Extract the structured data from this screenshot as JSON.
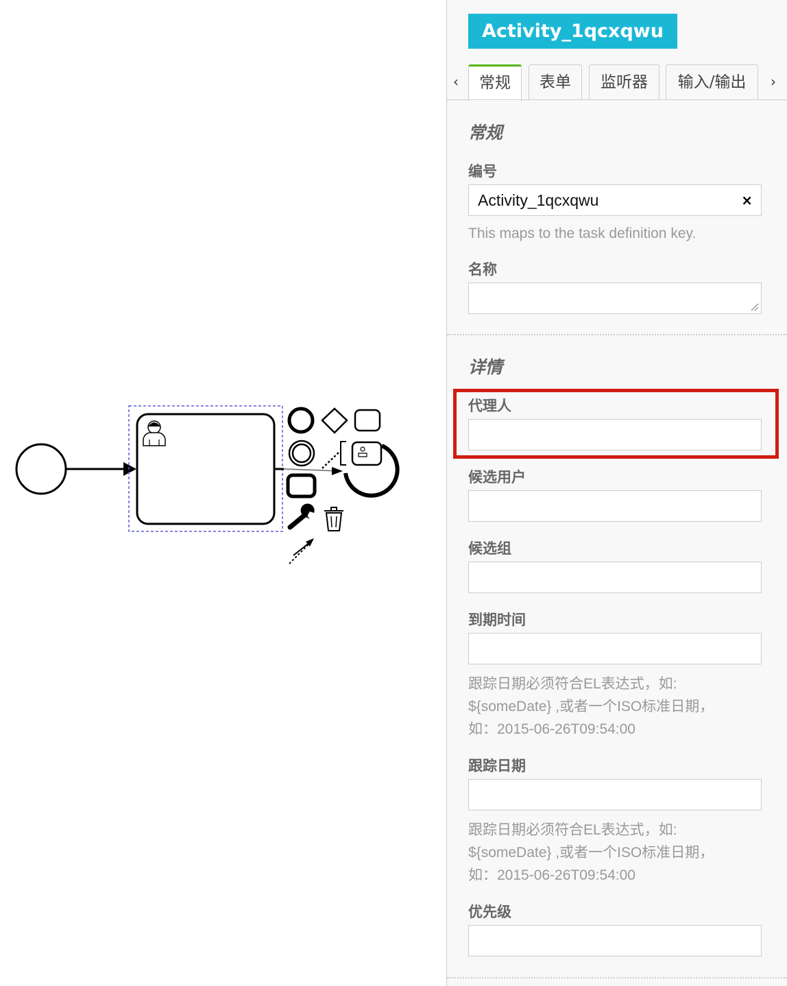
{
  "panel": {
    "title": "Activity_1qcxqwu",
    "tabs": [
      {
        "label": "常规",
        "active": true
      },
      {
        "label": "表单",
        "active": false
      },
      {
        "label": "监听器",
        "active": false
      },
      {
        "label": "输入/输出",
        "active": false
      }
    ],
    "tab_prev_symbol": "‹",
    "tab_next_symbol": "›",
    "general": {
      "heading": "常规",
      "id_label": "编号",
      "id_value": "Activity_1qcxqwu",
      "clear_symbol": "×",
      "id_description": "This maps to the task definition key.",
      "name_label": "名称",
      "name_value": ""
    },
    "details": {
      "heading": "详情",
      "assignee_label": "代理人",
      "candidate_users_label": "候选用户",
      "candidate_groups_label": "候选组",
      "due_date_label": "到期时间",
      "due_date_description_1": "跟踪日期必须符合EL表达式，如:",
      "due_date_description_2": "${someDate} ,或者一个ISO标准日期，",
      "due_date_description_3": "如：2015-06-26T09:54:00",
      "follow_up_label": "跟踪日期",
      "follow_up_description_1": "跟踪日期必须符合EL表达式，如:",
      "follow_up_description_2": "${someDate} ,或者一个ISO标准日期，",
      "follow_up_description_3": "如：2015-06-26T09:54:00",
      "priority_label": "优先级"
    }
  },
  "colors": {
    "title_bg": "#1bb8d6",
    "active_tab_accent": "#52b415",
    "highlight": "#d01d12",
    "selection_outline": "#5b5bd6"
  },
  "diagram": {
    "elements": [
      "start-event",
      "sequence-flow",
      "user-task",
      "context-pad"
    ]
  }
}
